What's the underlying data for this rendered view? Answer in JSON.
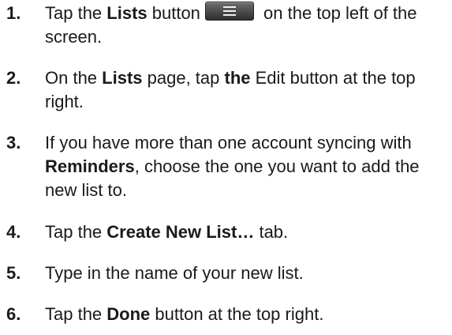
{
  "steps": [
    {
      "number": "1.",
      "parts": [
        "Tap the ",
        "Lists",
        " button",
        " on the top left of the screen."
      ],
      "icon": "menu-icon"
    },
    {
      "number": "2.",
      "parts": [
        "On the ",
        "Lists",
        " page, tap ",
        "the",
        " Edit button at the top right."
      ]
    },
    {
      "number": "3.",
      "parts": [
        "If you have more than one account syncing with ",
        "Reminders",
        ", choose the one you want to add the new list to."
      ]
    },
    {
      "number": "4.",
      "parts": [
        "Tap the ",
        "Create New List…",
        " tab."
      ]
    },
    {
      "number": "5.",
      "parts": [
        "Type in the name of your new list."
      ]
    },
    {
      "number": "6.",
      "parts": [
        "Tap the ",
        "Done",
        " button at the top right."
      ]
    }
  ]
}
